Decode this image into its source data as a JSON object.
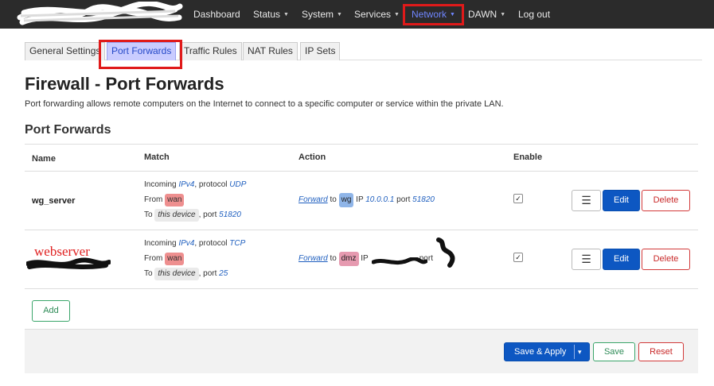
{
  "nav": {
    "items": [
      {
        "label": "Dashboard",
        "dropdown": false
      },
      {
        "label": "Status",
        "dropdown": true
      },
      {
        "label": "System",
        "dropdown": true
      },
      {
        "label": "Services",
        "dropdown": true
      },
      {
        "label": "Network",
        "dropdown": true,
        "active": true
      },
      {
        "label": "DAWN",
        "dropdown": true
      },
      {
        "label": "Log out",
        "dropdown": false
      }
    ]
  },
  "tabs": [
    {
      "label": "General Settings"
    },
    {
      "label": "Port Forwards",
      "active": true
    },
    {
      "label": "Traffic Rules"
    },
    {
      "label": "NAT Rules"
    },
    {
      "label": "IP Sets"
    }
  ],
  "page": {
    "title": "Firewall - Port Forwards",
    "description": "Port forwarding allows remote computers on the Internet to connect to a specific computer or service within the private LAN.",
    "section_title": "Port Forwards"
  },
  "table": {
    "headers": {
      "name": "Name",
      "match": "Match",
      "action": "Action",
      "enable": "Enable"
    },
    "rows": [
      {
        "name": "wg_server",
        "match": {
          "incoming_prefix": "Incoming ",
          "family": "IPv4",
          "protocol_prefix": ", protocol ",
          "protocol": "UDP",
          "from_prefix": "From ",
          "from_zone": "wan",
          "to_prefix": "To ",
          "to_target": "this device",
          "port_prefix": ", port ",
          "port": "51820"
        },
        "action": {
          "verb": "Forward",
          "to_word": " to ",
          "zone": "wg",
          "ip_label": " IP ",
          "ip": "10.0.0.1",
          "port_label": " port ",
          "port": "51820"
        },
        "enabled": true
      },
      {
        "name": "webserver",
        "match": {
          "incoming_prefix": "Incoming ",
          "family": "IPv4",
          "protocol_prefix": ", protocol ",
          "protocol": "TCP",
          "from_prefix": "From ",
          "from_zone": "wan",
          "to_prefix": "To ",
          "to_target": "this device",
          "port_prefix": ", port ",
          "port": "25"
        },
        "action": {
          "verb": "Forward",
          "to_word": " to ",
          "zone": "dmz",
          "ip_label": " IP",
          "port_label": "port"
        },
        "enabled": true
      }
    ],
    "row_buttons": {
      "menu": "☰",
      "edit": "Edit",
      "delete": "Delete"
    }
  },
  "buttons": {
    "add": "Add",
    "save_apply": "Save & Apply",
    "save_apply_dropdown": "▾",
    "save": "Save",
    "reset": "Reset"
  },
  "colors": {
    "topbar": "#2b2b2b",
    "highlight_box": "#e01a1a",
    "primary": "#0d57c2",
    "positive": "#2e8b57",
    "negative": "#c92a2a",
    "zone_wan": "#ee8f8f",
    "zone_wg": "#8fb5e8",
    "zone_dmz": "#e69ab0"
  }
}
